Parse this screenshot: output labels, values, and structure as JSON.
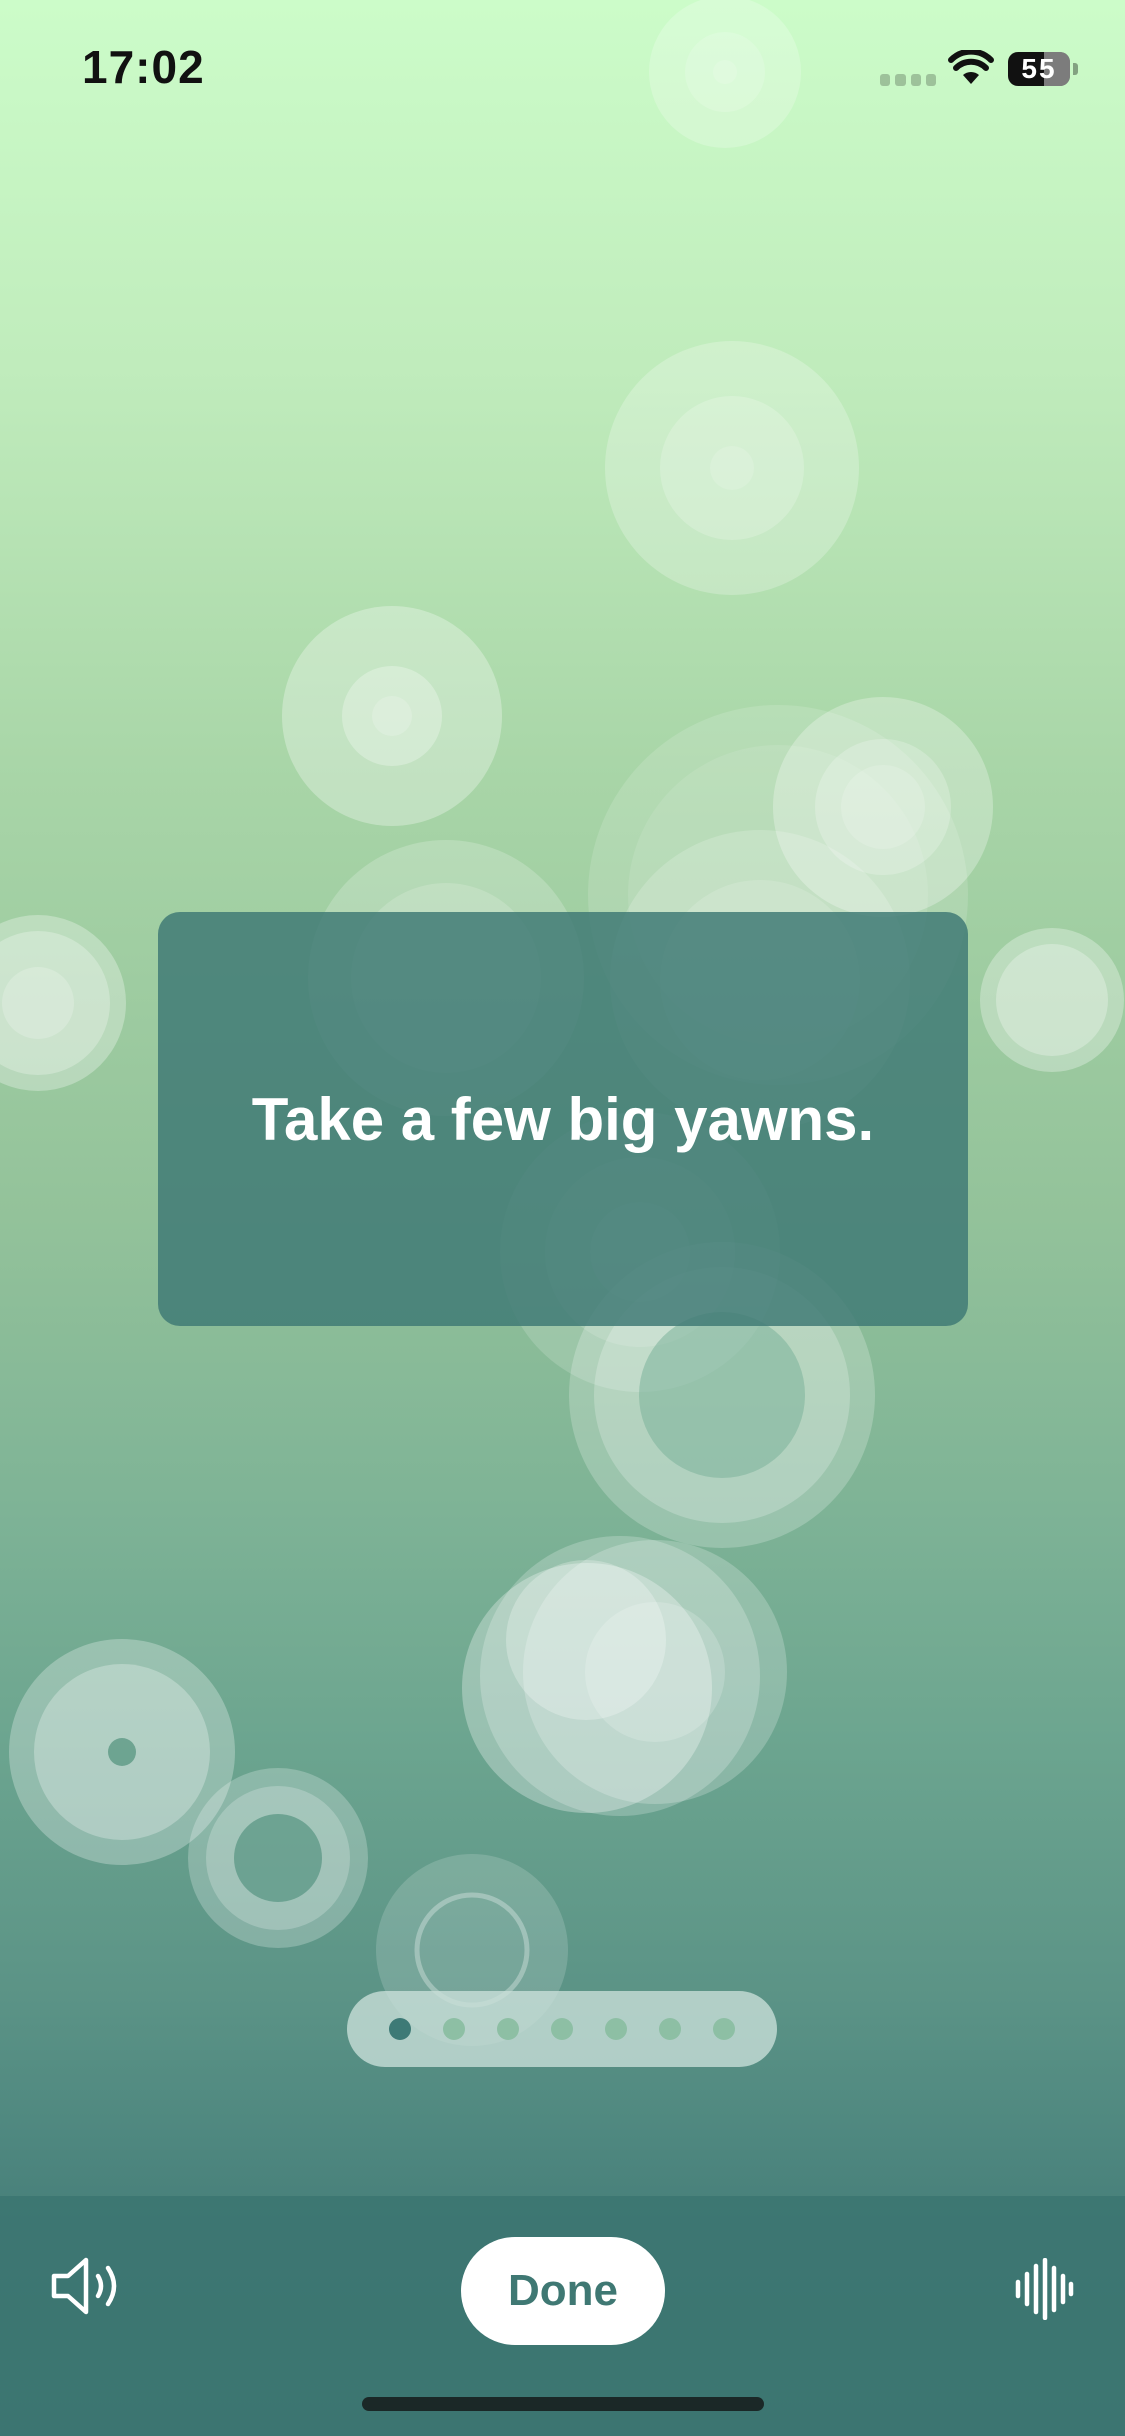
{
  "status_bar": {
    "time": "17:02",
    "battery_level": "55"
  },
  "prompt": {
    "text": "Take a few big yawns."
  },
  "pager": {
    "total_pages": 7,
    "current_page": 1
  },
  "controls": {
    "done_label": "Done",
    "speaker_icon": "speaker-icon",
    "waveform_icon": "waveform-icon"
  },
  "colors": {
    "accent": "#3f7873",
    "card": "#3f7975",
    "dot_active": "#3d7a76",
    "dot_inactive": "#8dbfa4"
  }
}
